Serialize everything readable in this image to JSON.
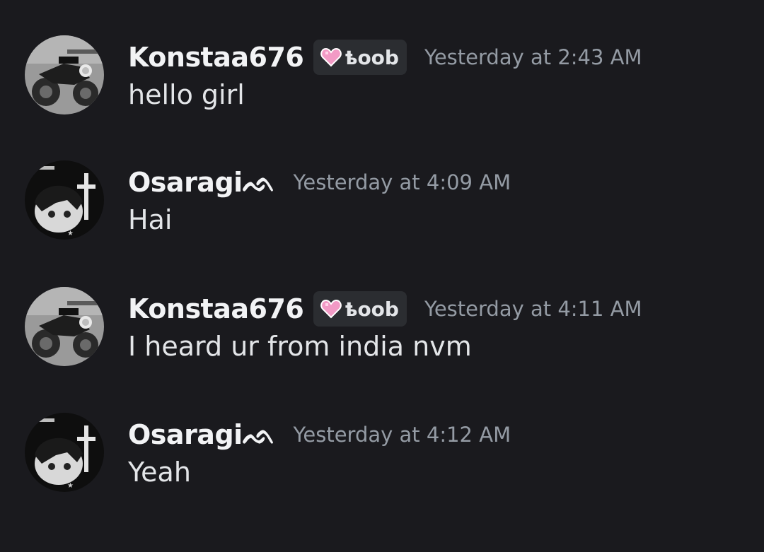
{
  "messages": [
    {
      "username": "Konstaa676",
      "avatar_icon": "motorcycle-avatar",
      "tag": {
        "icon": "pink-heart-icon",
        "text": "ҍoob"
      },
      "timestamp": "Yesterday at 2:43 AM",
      "content": "hello girl"
    },
    {
      "username": "Osaragiᨒ",
      "avatar_icon": "anime-cross-avatar",
      "timestamp": "Yesterday at 4:09 AM",
      "content": "Hai"
    },
    {
      "username": "Konstaa676",
      "avatar_icon": "motorcycle-avatar",
      "tag": {
        "icon": "pink-heart-icon",
        "text": "ҍoob"
      },
      "timestamp": "Yesterday at 4:11 AM",
      "content": "I heard ur from india nvm"
    },
    {
      "username": "Osaragiᨒ",
      "avatar_icon": "anime-cross-avatar",
      "timestamp": "Yesterday at 4:12 AM",
      "content": "Yeah"
    }
  ],
  "colors": {
    "background": "#1a1a1e",
    "username": "#f2f3f5",
    "timestamp": "#949ba4",
    "tag_background": "#2b2d31",
    "heart": "#f29ac5"
  }
}
